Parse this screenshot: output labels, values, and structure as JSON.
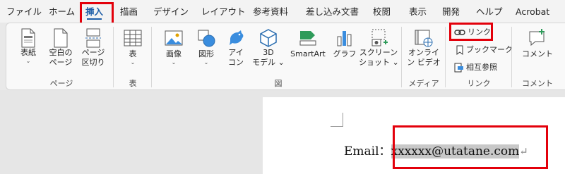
{
  "tabs": [
    {
      "label": "ファイル"
    },
    {
      "label": "ホーム"
    },
    {
      "label": "挿入"
    },
    {
      "label": "描画"
    },
    {
      "label": "デザイン"
    },
    {
      "label": "レイアウト"
    },
    {
      "label": "参考資料"
    },
    {
      "label": "差し込み文書"
    },
    {
      "label": "校閲"
    },
    {
      "label": "表示"
    },
    {
      "label": "開発"
    },
    {
      "label": "ヘルプ"
    },
    {
      "label": "Acrobat"
    }
  ],
  "groups": {
    "page": {
      "label": "ページ",
      "cover": [
        "表紙",
        "⌄"
      ],
      "blank": [
        "空白の",
        "ページ"
      ],
      "break": [
        "ページ",
        "区切り"
      ]
    },
    "table": {
      "label": "表",
      "table": [
        "表",
        "⌄"
      ]
    },
    "illustrations": {
      "label": "図",
      "picture": [
        "画像",
        "⌄"
      ],
      "shapes": [
        "図形",
        "⌄"
      ],
      "icons": [
        "アイ",
        "コン"
      ],
      "model3d": [
        "3D",
        "モデル ⌄"
      ],
      "smartart": "SmartArt",
      "chart": "グラフ",
      "screenshot": [
        "スクリーン",
        "ショット ⌄"
      ]
    },
    "media": {
      "label": "メディア",
      "video": [
        "オンライ",
        "ン ビデオ"
      ]
    },
    "links": {
      "label": "リンク",
      "link": "リンク",
      "bookmark": "ブックマーク",
      "crossref": "相互参照"
    },
    "comments": {
      "label": "コメント",
      "comment": "コメント"
    }
  },
  "document": {
    "email_label": "Email：",
    "email_value": "xxxxxx@utatane.com",
    "para_mark": "↵"
  },
  "colors": {
    "accent": "#1f5fa8",
    "highlight_box": "#e3000b"
  }
}
